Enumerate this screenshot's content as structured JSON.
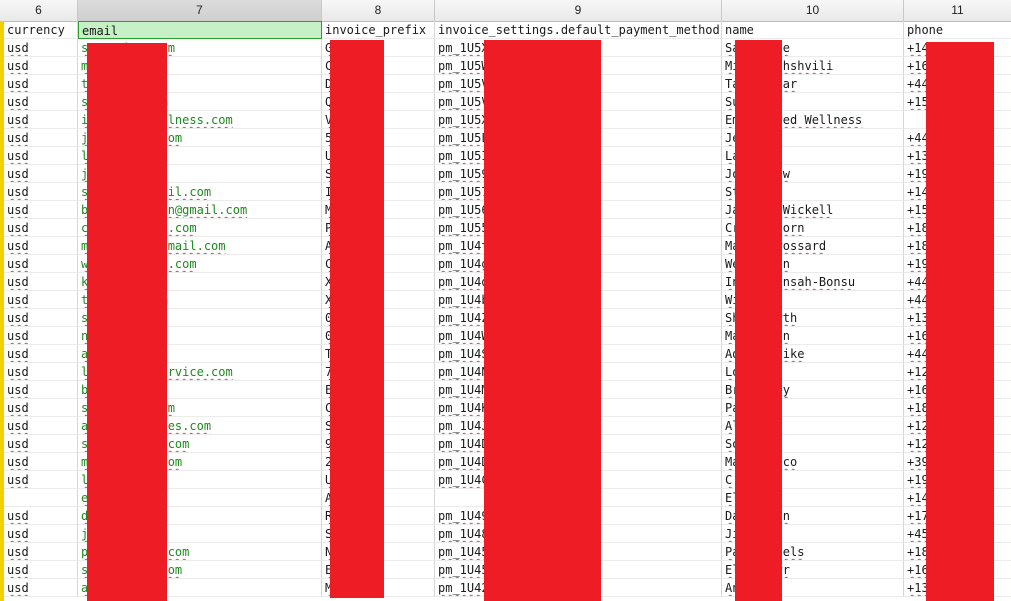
{
  "col_numbers": [
    "6",
    "7",
    "8",
    "9",
    "10",
    "11"
  ],
  "fields": [
    "currency",
    "email",
    "invoice_prefix",
    "invoice_settings.default_payment_method",
    "name",
    "phone"
  ],
  "rows": [
    {
      "currency": "usd",
      "email": "s          009ahoo.com",
      "prefix": "G",
      "pm": "pm_1U5X                 Lcj",
      "name": "Sa          Savage",
      "phone": "+14"
    },
    {
      "currency": "usd",
      "email": "m          hands.ca",
      "prefix": "C",
      "pm": "pm_1U5W                 GKA",
      "name": "Mi          Mamychshvili",
      "phone": "+16"
    },
    {
      "currency": "usd",
      "email": "t          .com",
      "prefix": "D",
      "pm": "pm_1U5V                 Aex",
      "name": "Ta          ftakhar",
      "phone": "+44"
    },
    {
      "currency": "usd",
      "email": "s          regory.com",
      "prefix": "Q",
      "pm": "pm_1U5V                 uQ9",
      "name": "Su          egory",
      "phone": "+15"
    },
    {
      "currency": "usd",
      "email": "i          nspiredwellness.com",
      "prefix": "V",
      "pm": "pm_1U5X                 HPza",
      "name": "Em          nspired Wellness",
      "phone": ""
    },
    {
      "currency": "usd",
      "email": "j          79@gmail.com",
      "prefix": "5",
      "pm": "pm_1U5L                 JeuW",
      "name": "Je          ward",
      "phone": "+44"
    },
    {
      "currency": "usd",
      "email": "l          ei.com",
      "prefix": "U",
      "pm": "pm_1U5I                 7IFb",
      "name": "La          ones",
      "phone": "+13"
    },
    {
      "currency": "usd",
      "email": "j          mail.com",
      "prefix": "S",
      "pm": "pm_1U59                 2ZI",
      "name": "Jo          oselaw",
      "phone": "+19"
    },
    {
      "currency": "usd",
      "email": "s          mifilm@gmail.com",
      "prefix": "I",
      "pm": "pm_1U57                 6gLz",
      "name": "St          arry",
      "phone": "+14"
    },
    {
      "currency": "usd",
      "email": "b          onnutrition@gmail.com",
      "prefix": "M",
      "pm": "pm_1U56                 RW49",
      "name": "Ja          Dawn Wickell",
      "phone": "+15"
    },
    {
      "currency": "usd",
      "email": "c          horn@gmail.com",
      "prefix": "P",
      "pm": "pm_1U55                 WZq",
      "name": "Cr          Langhorn",
      "phone": "+18"
    },
    {
      "currency": "usd",
      "email": "m          ssard817@gmail.com",
      "prefix": "A",
      "pm": "pm_1U4t                 KDP",
      "name": "Ma          se Brossard",
      "phone": "+18"
    },
    {
      "currency": "usd",
      "email": "w          h333@gmail.com",
      "prefix": "C",
      "pm": "pm_1U4g                 4UB",
      "name": "We          cobson",
      "phone": "+19"
    },
    {
      "currency": "usd",
      "email": "k          oo.co.uk",
      "prefix": "X",
      "pm": "pm_1U4d                 a3yU",
      "name": "In          ei-Mensah-Bonsu",
      "phone": "+44"
    },
    {
      "currency": "usd",
      "email": "t          @gmail.com",
      "prefix": "X",
      "pm": "pm_1U4b                 TWQ",
      "name": "Wi          Bonds",
      "phone": "+44"
    },
    {
      "currency": "usd",
      "email": "s          mail.com",
      "prefix": "0",
      "pm": "pm_1U4Z                 WcK",
      "name": "Sh          dsworth",
      "phone": "+13"
    },
    {
      "currency": "usd",
      "email": "n          ail.com",
      "prefix": "0",
      "pm": "pm_1U4W                 6PBn",
      "name": "Ma          Norton",
      "phone": "+16"
    },
    {
      "currency": "usd",
      "email": "a          ahoo.com",
      "prefix": "T",
      "pm": "pm_1U4S                 2CvZ",
      "name": "Ad          fezulike",
      "phone": "+44"
    },
    {
      "currency": "usd",
      "email": "l          sibilityservice.com",
      "prefix": "7",
      "pm": "pm_1U4N                 in6A",
      "name": "Lo          ixson",
      "phone": "+12"
    },
    {
      "currency": "usd",
      "email": "b          ail.com",
      "prefix": "E",
      "pm": "pm_1U4M                 FXiy",
      "name": "Br          Goudey",
      "phone": "+16"
    },
    {
      "currency": "usd",
      "email": "s          0@gmail.com",
      "prefix": "C",
      "pm": "pm_1U4K                 Hule",
      "name": "Pa          lley",
      "phone": "+18"
    },
    {
      "currency": "usd",
      "email": "a          rdministries.com",
      "prefix": "S",
      "pm": "pm_1U4J                 0XAC",
      "name": "Al          uley",
      "phone": "+12"
    },
    {
      "currency": "usd",
      "email": "s          han@gmail.com",
      "prefix": "9",
      "pm": "pm_1U4D                 L447",
      "name": "So          ephan",
      "phone": "+12"
    },
    {
      "currency": "usd",
      "email": "m          to@gmail.com",
      "prefix": "2",
      "pm": "pm_1U4D                 56r",
      "name": "Ma          angreco",
      "phone": "+39"
    },
    {
      "currency": "usd",
      "email": "l          ail.com",
      "prefix": "U",
      "pm": "pm_1U4C                 6gLT",
      "name": "C          Hicks",
      "phone": "+19"
    },
    {
      "currency": "",
      "email": "e          gmail.com",
      "prefix": "A",
      "pm": "",
      "name": "El          n",
      "phone": "+14"
    },
    {
      "currency": "usd",
      "email": "d          l.com",
      "prefix": "R",
      "pm": "pm_1U49                 mLRS",
      "name": "Da          derson",
      "phone": "+17"
    },
    {
      "currency": "usd",
      "email": "j          hoo.com",
      "prefix": "S",
      "pm": "pm_1U48                 UKh",
      "name": "Ji          ch",
      "phone": "+45"
    },
    {
      "currency": "usd",
      "email": "p          els@gmail.com",
      "prefix": "N",
      "pm": "pm_1U45                 AC2L",
      "name": "Pa          Michaels",
      "phone": "+18"
    },
    {
      "currency": "usd",
      "email": "s          el@gmail.com",
      "prefix": "E",
      "pm": "pm_1U45                 DZo6",
      "name": "El          n Carr",
      "phone": "+16"
    },
    {
      "currency": "usd",
      "email": "a          ail.com",
      "prefix": "M",
      "pm": "pm_1U42                 wZ6",
      "name": "An          kes",
      "phone": "+13"
    }
  ],
  "colors": {
    "redaction": "#ee1c25",
    "email_text": "#1d8a1d",
    "selected_header_bg": "#c6f0c6",
    "spell_squiggle": "#e04848",
    "gutter": "#f2d100"
  }
}
